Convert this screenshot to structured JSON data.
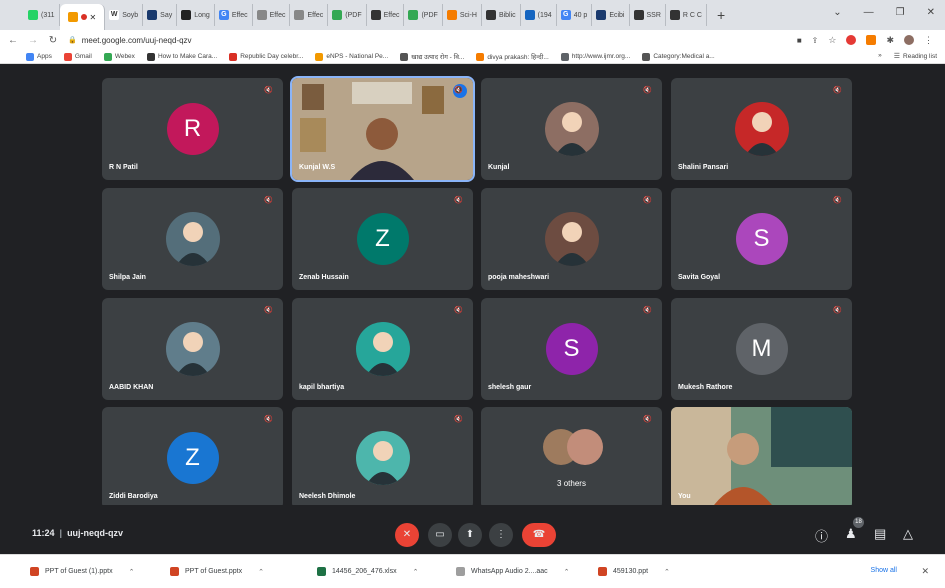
{
  "browser": {
    "tabs": [
      {
        "label": "(311",
        "fav_color": "#25d366",
        "fav_char": ""
      },
      {
        "label": "",
        "fav_color": "#f29900",
        "fav_char": "",
        "active": true
      },
      {
        "label": "Soyb",
        "fav_color": "#ffffff",
        "fav_char": "W"
      },
      {
        "label": "Say",
        "fav_color": "#1a3a6e",
        "fav_char": ""
      },
      {
        "label": "Long",
        "fav_color": "#222222",
        "fav_char": ""
      },
      {
        "label": "Effec",
        "fav_color": "#4285f4",
        "fav_char": "G"
      },
      {
        "label": "Effec",
        "fav_color": "#888888",
        "fav_char": ""
      },
      {
        "label": "Effec",
        "fav_color": "#888888",
        "fav_char": ""
      },
      {
        "label": "(PDF",
        "fav_color": "#34a853",
        "fav_char": ""
      },
      {
        "label": "Effec",
        "fav_color": "#333333",
        "fav_char": ""
      },
      {
        "label": "(PDF",
        "fav_color": "#34a853",
        "fav_char": ""
      },
      {
        "label": "Sci-H",
        "fav_color": "#f57c00",
        "fav_char": ""
      },
      {
        "label": "Biblic",
        "fav_color": "#333333",
        "fav_char": ""
      },
      {
        "label": "(194",
        "fav_color": "#1565c0",
        "fav_char": ""
      },
      {
        "label": "40 p",
        "fav_color": "#4285f4",
        "fav_char": "G"
      },
      {
        "label": "Ecibi",
        "fav_color": "#1a3a6e",
        "fav_char": ""
      },
      {
        "label": "SSR",
        "fav_color": "#333333",
        "fav_char": ""
      },
      {
        "label": "R C C",
        "fav_color": "#333333",
        "fav_char": ""
      }
    ],
    "new_tab": "+",
    "window_controls": [
      "⌄",
      "—",
      "❐",
      "✕"
    ],
    "url": "meet.google.com/uuj-neqd-qzv"
  },
  "bookmarks": {
    "items": [
      {
        "label": "Apps",
        "fav_color": "#4285f4"
      },
      {
        "label": "Gmail",
        "fav_color": "#ea4335"
      },
      {
        "label": "Webex",
        "fav_color": "#34a853"
      },
      {
        "label": "How to Make Cara...",
        "fav_color": "#333333"
      },
      {
        "label": "Republic Day celebr...",
        "fav_color": "#d93025"
      },
      {
        "label": "eNPS - National Pe...",
        "fav_color": "#f29900"
      },
      {
        "label": "खाद्य उत्पाद रोग - वि...",
        "fav_color": "#555555"
      },
      {
        "label": "divya prakash: हिन्दी...",
        "fav_color": "#f57c00"
      },
      {
        "label": "http://www.ijmr.org...",
        "fav_color": "#5f6368"
      },
      {
        "label": "Category:Medical a...",
        "fav_color": "#555555"
      }
    ],
    "more": "»",
    "reading_list": "Reading list"
  },
  "meet": {
    "participants": [
      {
        "name": "R N Patil",
        "kind": "letter",
        "letter": "R",
        "color": "#c2185b"
      },
      {
        "name": "Kunjal W.S",
        "kind": "video",
        "speaking": true
      },
      {
        "name": "Kunjal",
        "kind": "photo",
        "color": "#8d6e63"
      },
      {
        "name": "Shalini Pansari",
        "kind": "photo",
        "color": "#c62828"
      },
      {
        "name": "Shilpa Jain",
        "kind": "photo",
        "color": "#546e7a"
      },
      {
        "name": "Zenab Hussain",
        "kind": "letter",
        "letter": "Z",
        "color": "#00796b"
      },
      {
        "name": "pooja maheshwari",
        "kind": "photo",
        "color": "#6d4c41"
      },
      {
        "name": "Savita Goyal",
        "kind": "letter",
        "letter": "S",
        "color": "#ab47bc"
      },
      {
        "name": "AABID KHAN",
        "kind": "photo",
        "color": "#607d8b"
      },
      {
        "name": "kapil bhartiya",
        "kind": "photo",
        "color": "#26a69a"
      },
      {
        "name": "shelesh gaur",
        "kind": "letter",
        "letter": "S",
        "color": "#8e24aa"
      },
      {
        "name": "Mukesh Rathore",
        "kind": "letter",
        "letter": "M",
        "color": "#5f6368"
      },
      {
        "name": "Ziddi Barodiya",
        "kind": "letter",
        "letter": "Z",
        "color": "#1976d2"
      },
      {
        "name": "Neelesh Dhimole",
        "kind": "photo",
        "color": "#4db6ac"
      },
      {
        "name": "",
        "kind": "others",
        "others_label": "3 others"
      },
      {
        "name": "You",
        "kind": "self"
      }
    ],
    "time": "11:24",
    "meeting_code": "uuj-neqd-qzv",
    "people_count": "18"
  },
  "downloads": {
    "items": [
      {
        "label": "PPT of Guest (1).pptx",
        "fav_color": "#d04423"
      },
      {
        "label": "PPT of Guest.pptx",
        "fav_color": "#d04423"
      },
      {
        "label": "14456_206_476.xlsx",
        "fav_color": "#1e7145"
      },
      {
        "label": "WhatsApp Audio 2....aac",
        "fav_color": "#9e9e9e"
      },
      {
        "label": "459130.ppt",
        "fav_color": "#d04423"
      }
    ],
    "show_all": "Show all",
    "close": "✕"
  }
}
